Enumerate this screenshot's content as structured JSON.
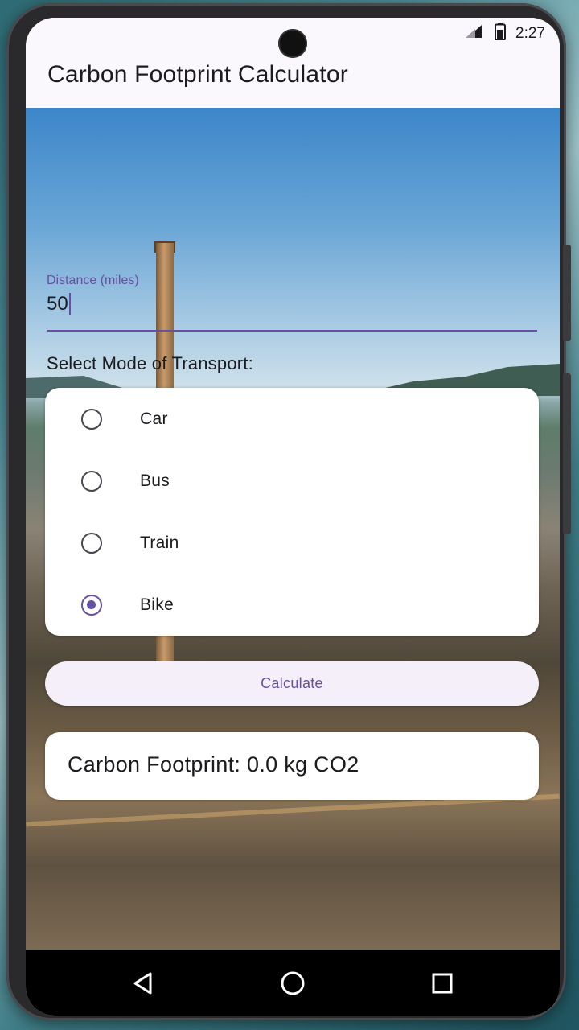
{
  "status_bar": {
    "time": "2:27",
    "signal_icon": "signal-icon",
    "battery_icon": "battery-icon"
  },
  "app": {
    "title": "Carbon Footprint Calculator"
  },
  "distance": {
    "label": "Distance (miles)",
    "value": "50"
  },
  "transport": {
    "section_label": "Select Mode of Transport:",
    "options": [
      {
        "label": "Car",
        "selected": false
      },
      {
        "label": "Bus",
        "selected": false
      },
      {
        "label": "Train",
        "selected": false
      },
      {
        "label": "Bike",
        "selected": true
      }
    ]
  },
  "calculate_button": {
    "label": "Calculate"
  },
  "result": {
    "text": "Carbon Footprint: 0.0 kg CO2"
  },
  "nav": {
    "back_icon": "back-triangle-icon",
    "home_icon": "home-circle-icon",
    "recents_icon": "recents-square-icon"
  },
  "colors": {
    "accent": "#6750a4",
    "surface": "#fbf8fd",
    "button_bg": "#f4eff8"
  }
}
